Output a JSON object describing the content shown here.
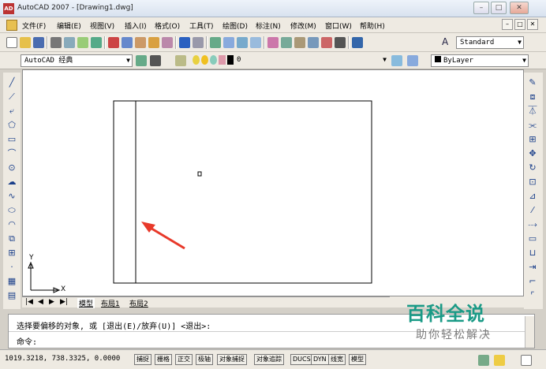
{
  "window": {
    "title": "AutoCAD 2007 - [Drawing1.dwg]",
    "app_icon": "AD",
    "minimize": "–",
    "maximize": "□",
    "close": "✕"
  },
  "menu": [
    {
      "label": "文件(F)"
    },
    {
      "label": "编辑(E)"
    },
    {
      "label": "视图(V)"
    },
    {
      "label": "插入(I)"
    },
    {
      "label": "格式(O)"
    },
    {
      "label": "工具(T)"
    },
    {
      "label": "绘图(D)"
    },
    {
      "label": "标注(N)"
    },
    {
      "label": "修改(M)"
    },
    {
      "label": "窗口(W)"
    },
    {
      "label": "帮助(H)"
    }
  ],
  "toolbar": {
    "text_style": "Standard",
    "workspace": "AutoCAD 经典",
    "layer": "0",
    "color": "ByLayer"
  },
  "layout_tabs": {
    "nav": [
      "|◀",
      "◀",
      "▶",
      "▶|"
    ],
    "model": "模型",
    "layout1": "布局1",
    "layout2": "布局2"
  },
  "ucs": {
    "x": "X",
    "y": "Y"
  },
  "command": {
    "line1": "选择要偏移的对象, 或 [退出(E)/放弃(U)] <退出>:",
    "line2": "命令:"
  },
  "status": {
    "coords": "1019.3218, 738.3325, 0.0000",
    "buttons": [
      "捕捉",
      "栅格",
      "正交",
      "极轴",
      "对象捕捉",
      "对象追踪",
      "DUCS",
      "DYN",
      "线宽",
      "模型"
    ]
  },
  "watermark": {
    "main": "百科全说",
    "sub": "助你轻松解决"
  },
  "colors": {
    "annotation_arrow": "#e8392a",
    "watermark": "#1a9a86"
  }
}
